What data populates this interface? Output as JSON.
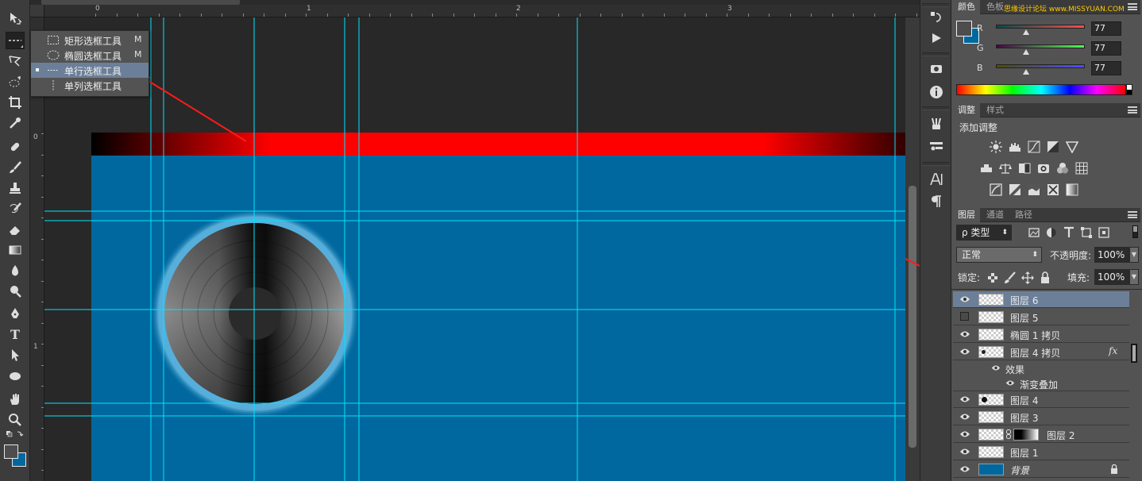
{
  "toolbar": {
    "tools": [
      "move-tool",
      "marquee-tool",
      "lasso-tool",
      "quick-select-tool",
      "crop-tool",
      "eyedropper-tool",
      "healing-tool",
      "brush-tool",
      "stamp-tool",
      "history-brush-tool",
      "eraser-tool",
      "gradient-tool",
      "blur-tool",
      "dodge-tool",
      "pen-tool",
      "type-tool",
      "path-select-tool",
      "shape-tool",
      "hand-tool",
      "zoom-tool"
    ],
    "type_tool_glyph": "T"
  },
  "rulers": {
    "h_labels": [
      "0",
      "1",
      "2",
      "3"
    ],
    "v_labels": [
      "0",
      "1"
    ]
  },
  "flyout": {
    "items": [
      {
        "label": "矩形选框工具",
        "key": "M"
      },
      {
        "label": "椭圆选框工具",
        "key": "M"
      },
      {
        "label": "单行选框工具",
        "key": ""
      },
      {
        "label": "单列选框工具",
        "key": ""
      }
    ],
    "selected_index": 2
  },
  "color_panel": {
    "tabs": [
      "颜色",
      "色板"
    ],
    "watermark": "思缘设计论坛 www.MISSYUAN.COM",
    "channels": [
      {
        "letter": "R",
        "value": "77"
      },
      {
        "letter": "G",
        "value": "77"
      },
      {
        "letter": "B",
        "value": "77"
      }
    ],
    "foreground": "#4d4d4d",
    "background": "#00689e"
  },
  "adjust_panel": {
    "tabs": [
      "调整",
      "样式"
    ],
    "heading": "添加调整"
  },
  "layers_panel": {
    "tabs": [
      "图层",
      "通道",
      "路径"
    ],
    "filter_label": "ρ 类型",
    "blend_mode": "正常",
    "opacity_label": "不透明度:",
    "opacity_value": "100%",
    "lock_label": "锁定:",
    "fill_label": "填充:",
    "fill_value": "100%",
    "layers": [
      {
        "name": "图层 6",
        "visible": true,
        "selected": true
      },
      {
        "name": "图层 5",
        "visible": false,
        "selected": false
      },
      {
        "name": "椭圆 1 拷贝",
        "visible": true,
        "selected": false
      },
      {
        "name": "图层 4 拷贝",
        "visible": true,
        "selected": false,
        "fx": "fx"
      },
      {
        "name": "效果",
        "visible": true,
        "sub": 1
      },
      {
        "name": "渐变叠加",
        "visible": true,
        "sub": 2
      },
      {
        "name": "图层 4",
        "visible": true,
        "selected": false
      },
      {
        "name": "图层 3",
        "visible": true,
        "selected": false
      },
      {
        "name": "图层 2",
        "visible": true,
        "selected": false,
        "masked": true
      },
      {
        "name": "图层 1",
        "visible": true,
        "selected": false
      },
      {
        "name": "背景",
        "visible": true,
        "selected": false,
        "locked": true
      }
    ]
  },
  "canvas": {
    "document_fill": "#00689e",
    "banner_color": "#ff0000",
    "guide_color": "#00e5ff"
  }
}
